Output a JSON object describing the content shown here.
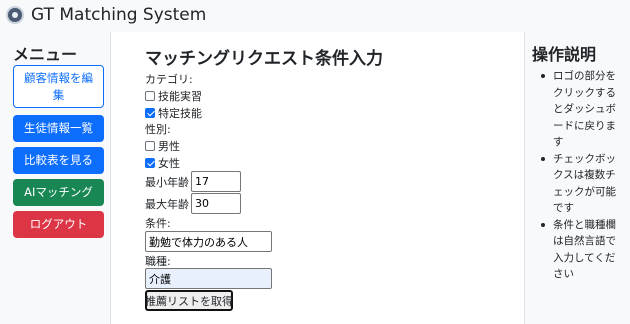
{
  "app": {
    "title": "GT Matching System"
  },
  "sidebar": {
    "heading": "メニュー",
    "items": [
      {
        "label": "顧客情報を編集",
        "color": "#0d6efd",
        "style": "outline"
      },
      {
        "label": "生徒情報一覧",
        "color": "#0d6efd",
        "style": "solid"
      },
      {
        "label": "比較表を見る",
        "color": "#0d6efd",
        "style": "solid"
      },
      {
        "label": "AIマッチング",
        "color": "#198754",
        "style": "solid"
      },
      {
        "label": "ログアウト",
        "color": "#dc3545",
        "style": "solid"
      }
    ]
  },
  "form": {
    "title": "マッチングリクエスト条件入力",
    "category_label": "カテゴリ:",
    "categories": [
      {
        "label": "技能実習",
        "checked": false
      },
      {
        "label": "特定技能",
        "checked": true
      }
    ],
    "gender_label": "性別:",
    "genders": [
      {
        "label": "男性",
        "checked": false
      },
      {
        "label": "女性",
        "checked": true
      }
    ],
    "min_age_label": "最小年齢",
    "min_age_value": "17",
    "max_age_label": "最大年齢",
    "max_age_value": "30",
    "condition_label": "条件:",
    "condition_value": "勤勉で体力のある人",
    "job_label": "職種:",
    "job_value": "介護",
    "submit_label": "推薦リストを取得"
  },
  "help": {
    "heading": "操作説明",
    "items": [
      "ロゴの部分をクリックするとダッシュボードに戻ります",
      "チェックボックスは複数チェックが可能です",
      "条件と職種欄は自然言語で入力してください"
    ]
  }
}
